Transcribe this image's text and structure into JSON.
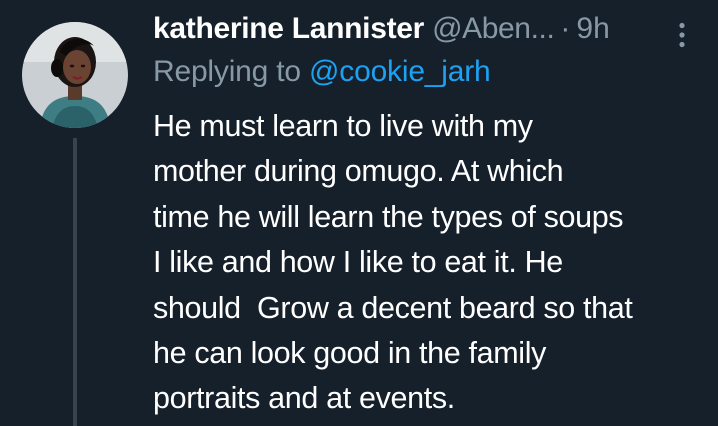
{
  "tweet": {
    "author": {
      "display_name": "katherine Lannister",
      "handle": "@Aben...",
      "avatar_icon": "profile-photo"
    },
    "separator": "·",
    "timestamp": "9h",
    "more_icon": "vertical-ellipsis-icon",
    "reply": {
      "prefix": "Replying to",
      "mention": "@cookie_jarh"
    },
    "body_lines": [
      "He must learn to live with my",
      "mother during omugo. At which",
      "time he will learn the types of soups",
      "I like and how I like to eat it. He",
      "should  Grow a decent beard so that",
      "he can look good in the family",
      "portraits and at events."
    ]
  },
  "colors": {
    "background": "#15202b",
    "secondary_text": "#8899a6",
    "link": "#1da1f2",
    "thread_line": "#38444d"
  }
}
